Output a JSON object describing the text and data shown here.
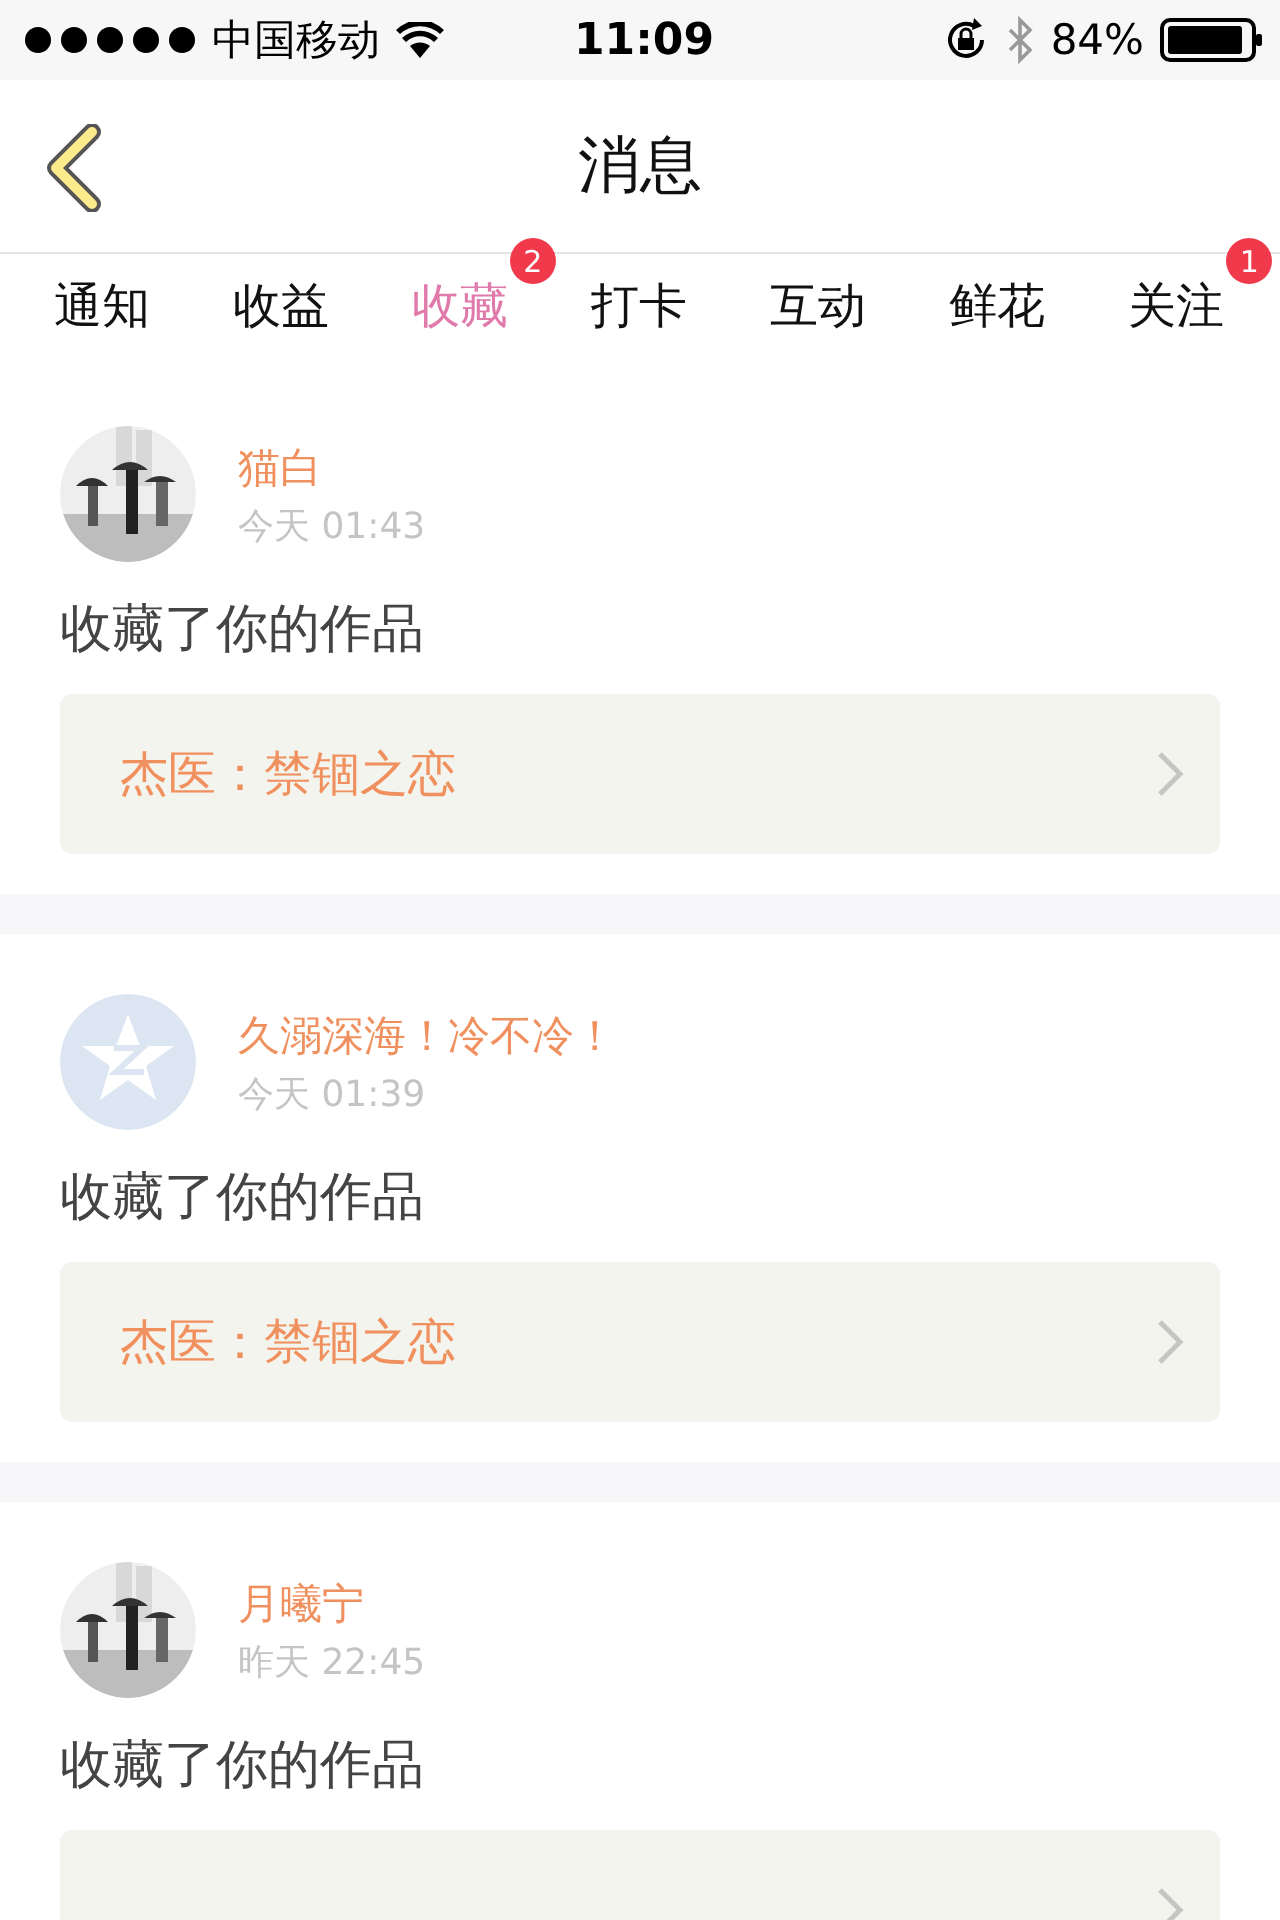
{
  "status_bar": {
    "carrier": "中国移动",
    "time": "11:09",
    "battery_text": "84%"
  },
  "nav": {
    "title": "消息"
  },
  "tabs": [
    {
      "label": "通知",
      "selected": false
    },
    {
      "label": "收益",
      "selected": false
    },
    {
      "label": "收藏",
      "selected": true,
      "badge": "2"
    },
    {
      "label": "打卡",
      "selected": false
    },
    {
      "label": "互动",
      "selected": false
    },
    {
      "label": "鲜花",
      "selected": false
    },
    {
      "label": "关注",
      "selected": false,
      "badge": "1"
    }
  ],
  "messages": [
    {
      "name": "猫白",
      "time": "今天 01:43",
      "text": "收藏了你的作品",
      "work": "杰医：禁锢之恋"
    },
    {
      "avatar": {
        "kind": "default"
      },
      "name": "久溺深海！冷不冷！",
      "time": "今天 01:39",
      "text": "收藏了你的作品",
      "work": "杰医：禁锢之恋"
    },
    {
      "name": "月曦宁",
      "time": "昨天 22:45",
      "text": "收藏了你的作品"
    }
  ]
}
